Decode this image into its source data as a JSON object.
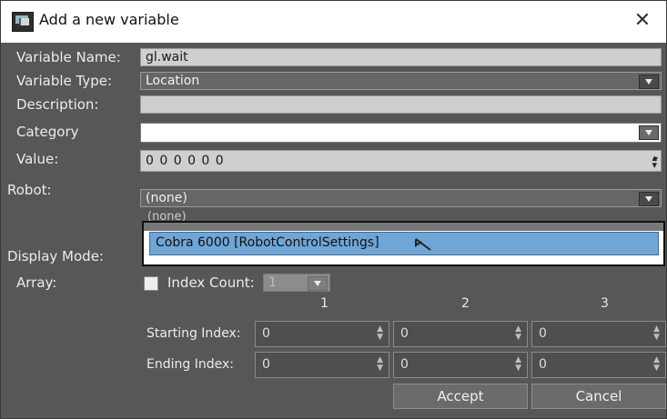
{
  "window": {
    "title": "Add a new variable",
    "close_glyph": "✕"
  },
  "form": {
    "variable_name": {
      "label": "Variable Name:",
      "value": "gl.wait"
    },
    "variable_type": {
      "label": "Variable Type:",
      "value": "Location"
    },
    "description": {
      "label": "Description:",
      "value": ""
    },
    "category": {
      "label": "Category",
      "value": ""
    },
    "value": {
      "label": "Value:",
      "value": "0 0 0 0 0 0"
    },
    "robot": {
      "label": "Robot:",
      "value": "(none)",
      "options": [
        "(none)",
        "Cobra 6000 [RobotControlSettings]"
      ],
      "highlighted": "Cobra 6000 [RobotControlSettings]"
    },
    "display_mode": {
      "label": "Display Mode:"
    },
    "array": {
      "label": "Array:",
      "checkbox_label": "Index Count:",
      "index_count": "1",
      "checked": false
    }
  },
  "index_table": {
    "columns": [
      "1",
      "2",
      "3"
    ],
    "rows": [
      {
        "label": "Starting Index:",
        "values": [
          "0",
          "0",
          "0"
        ]
      },
      {
        "label": "Ending Index:",
        "values": [
          "0",
          "0",
          "0"
        ]
      }
    ]
  },
  "buttons": {
    "accept": "Accept",
    "cancel": "Cancel"
  },
  "icons": {
    "app": "app-window-icon",
    "close": "close-icon",
    "dropdown": "chevron-down-icon",
    "spin": "spin-arrows-icon"
  }
}
